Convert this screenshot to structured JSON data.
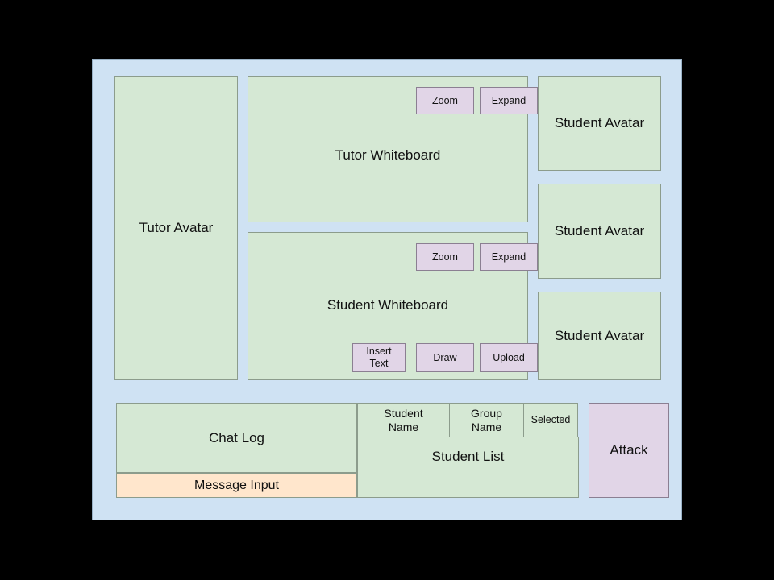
{
  "app": {
    "shell_name": "tutoring-session-layout"
  },
  "left_column": {
    "tutor_avatar": {
      "label": "Tutor Avatar"
    }
  },
  "center_column": {
    "tutor_whiteboard": {
      "title": "Tutor Whiteboard",
      "buttons": [
        {
          "name": "zoom",
          "label": "Zoom"
        },
        {
          "name": "expand",
          "label": "Expand"
        }
      ]
    },
    "student_whiteboard": {
      "title": "Student Whiteboard",
      "top_buttons": [
        {
          "name": "zoom",
          "label": "Zoom"
        },
        {
          "name": "expand",
          "label": "Expand"
        }
      ],
      "bottom_buttons": [
        {
          "name": "insert-text",
          "label_line1": "Insert",
          "label_line2": "Text"
        },
        {
          "name": "draw",
          "label": "Draw"
        },
        {
          "name": "upload",
          "label": "Upload"
        }
      ]
    }
  },
  "right_column": {
    "student_avatars": [
      {
        "label": "Student Avatar"
      },
      {
        "label": "Student Avatar"
      },
      {
        "label": "Student Avatar"
      }
    ]
  },
  "bottom_region": {
    "chat": {
      "log_label": "Chat Log",
      "message_input_label": "Message Input"
    },
    "student_list": {
      "columns": [
        {
          "name": "student-name",
          "line1": "Student",
          "line2": "Name"
        },
        {
          "name": "group-name",
          "line1": "Group",
          "line2": "Name"
        },
        {
          "name": "selected",
          "line1": "Selected",
          "line2": ""
        }
      ],
      "body_label": "Student List"
    },
    "attack": {
      "label": "Attack"
    }
  },
  "colors": {
    "canvas_background": "#000000",
    "shell_background": "#cfe2f3",
    "panel_green": "#d5e8d4",
    "panel_green_border": "#8c9c8c",
    "button_purple": "#e1d5e7",
    "button_purple_border": "#8b7f92",
    "input_cream": "#ffe6cc",
    "text": "#111111"
  }
}
